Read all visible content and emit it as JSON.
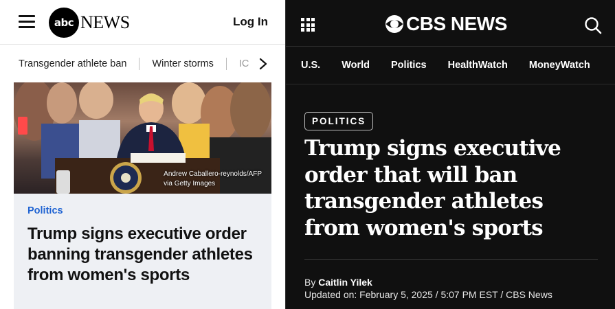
{
  "abc": {
    "logo_circle": "abc",
    "logo_word": "NEWS",
    "login": "Log In",
    "topics": [
      "Transgender athlete ban",
      "Winter storms",
      "IC"
    ],
    "photo_credit_line1": "Andrew Caballero-reynolds/AFP",
    "photo_credit_line2": "via Getty Images",
    "section": "Politics",
    "headline": "Trump signs executive order banning transgender athletes from women's sports",
    "icons": {
      "menu": "hamburger-menu-icon",
      "next": "chevron-right-icon"
    },
    "colors": {
      "section": "#1f63d2",
      "card_bg": "#eef0f4"
    }
  },
  "cbs": {
    "logo_word": "CBS NEWS",
    "nav": [
      "U.S.",
      "World",
      "Politics",
      "HealthWatch",
      "MoneyWatch"
    ],
    "tag": "POLITICS",
    "headline": "Trump signs executive order that will ban transgender athletes from women's sports",
    "by_prefix": "By ",
    "author": "Caitlin Yilek",
    "updated": "Updated on: February 5, 2025 / 5:07 PM EST / CBS News",
    "icons": {
      "apps": "apps-grid-icon",
      "search": "search-icon",
      "logo": "cbs-eye-icon"
    },
    "colors": {
      "background": "#101010"
    }
  }
}
